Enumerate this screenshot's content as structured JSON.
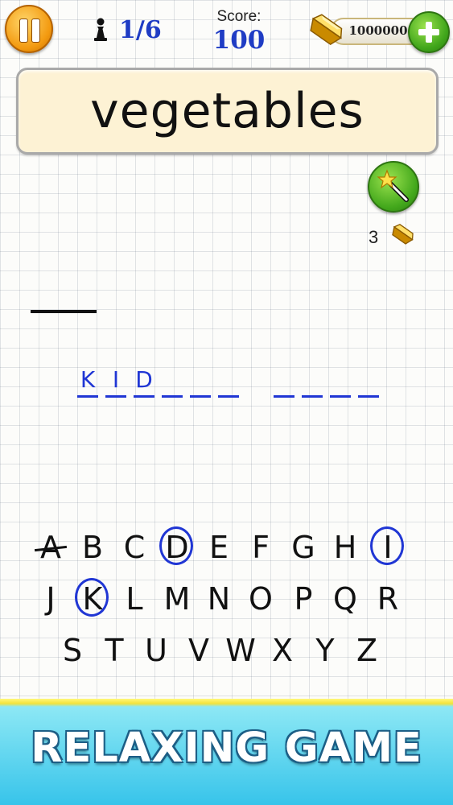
{
  "header": {
    "level": "1/6",
    "score_label": "Score:",
    "score_value": "100",
    "coins": "1000000"
  },
  "category": "vegetables",
  "hint": {
    "cost": "3"
  },
  "word": {
    "slots": [
      "K",
      "I",
      "D",
      "",
      "",
      "",
      "",
      "",
      "",
      ""
    ]
  },
  "keyboard": {
    "row1": [
      "A",
      "B",
      "C",
      "D",
      "E",
      "F",
      "G",
      "H",
      "I"
    ],
    "row2": [
      "J",
      "K",
      "L",
      "M",
      "N",
      "O",
      "P",
      "Q",
      "R"
    ],
    "row3": [
      "S",
      "T",
      "U",
      "V",
      "W",
      "X",
      "Y",
      "Z"
    ],
    "circled": [
      "D",
      "I",
      "K"
    ],
    "struck": [
      "A"
    ]
  },
  "banner": {
    "text": "RELAXING GAME"
  },
  "icons": [
    "pause-icon",
    "pawn-icon",
    "gold-bar-icon",
    "plus-icon",
    "magic-wand-icon"
  ],
  "colors": {
    "ink_blue": "#2036d4",
    "card_bg": "#fdf2d4",
    "banner_top": "#f2e23a",
    "banner_bottom": "#37c4ea"
  }
}
